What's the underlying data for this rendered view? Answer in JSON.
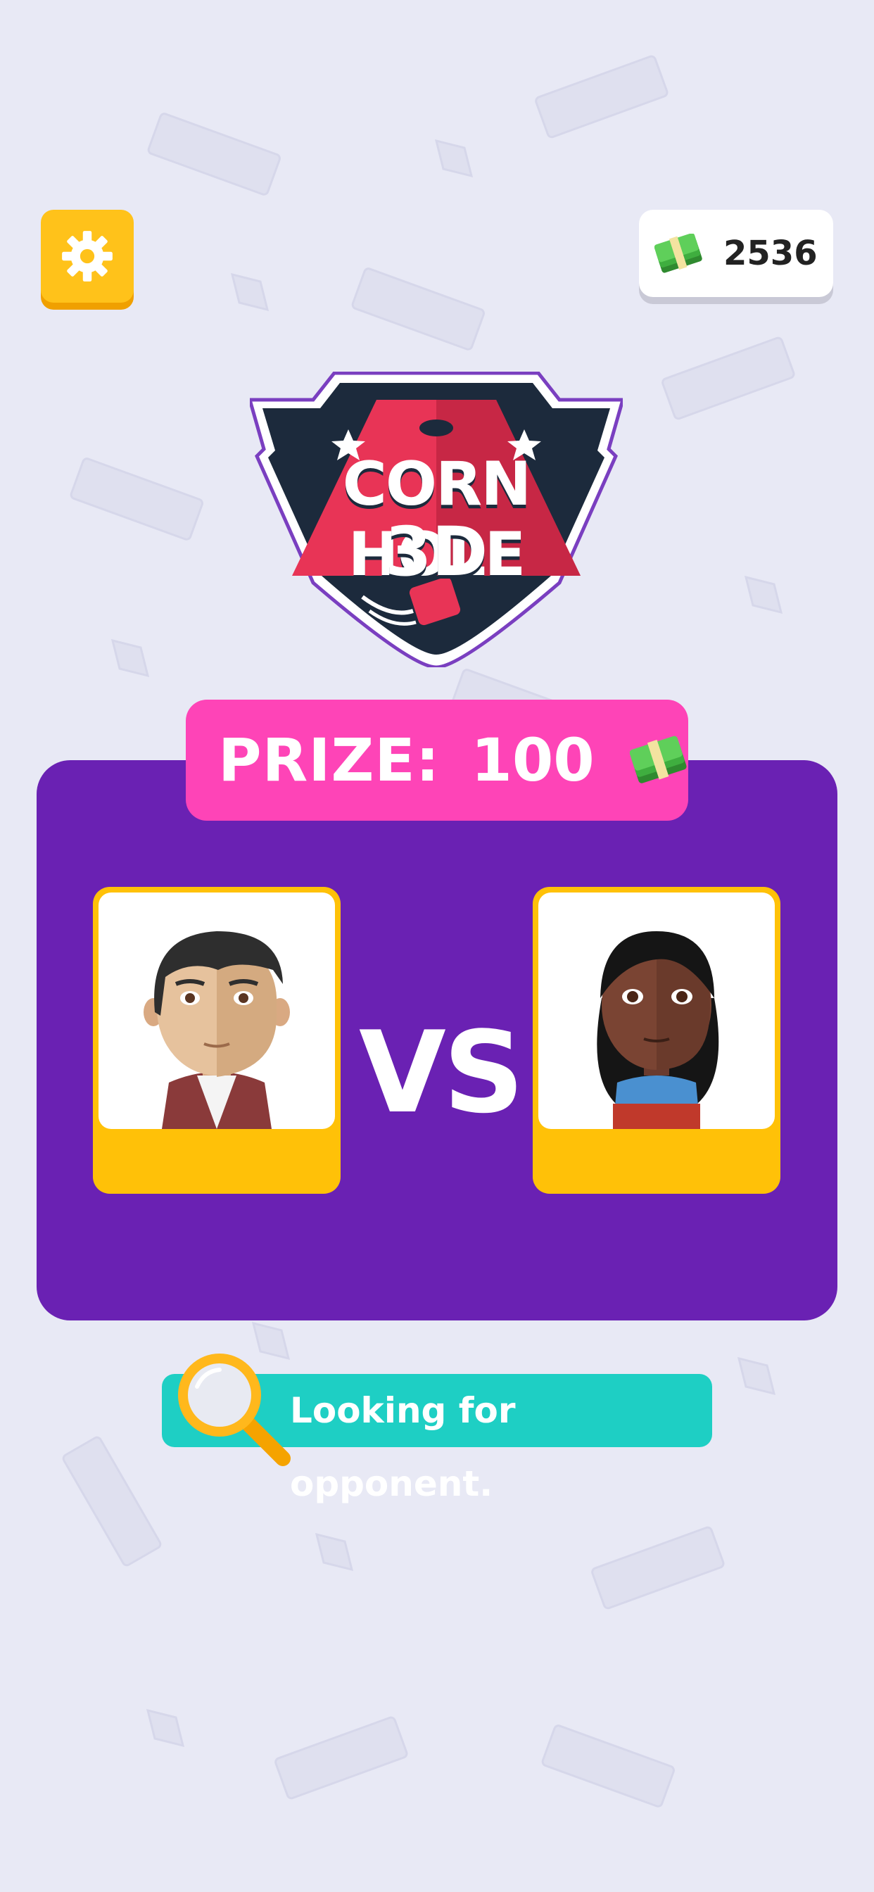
{
  "header": {
    "settings_icon": "gear-icon",
    "currency": {
      "icon": "cash-stack-icon",
      "amount": "2536"
    }
  },
  "logo": {
    "title": "CORN HOLE",
    "subtitle": "3D"
  },
  "prize": {
    "label": "PRIZE:",
    "amount": "100",
    "icon": "cash-stack-icon"
  },
  "match": {
    "vs_label": "VS",
    "player_left": {
      "avatar": "male-avatar"
    },
    "player_right": {
      "avatar": "female-avatar"
    }
  },
  "status": {
    "text": "Looking for opponent.",
    "icon": "magnifier-icon"
  },
  "colors": {
    "background": "#e8e9f5",
    "settings": "#ffc21a",
    "panel": "#6a21b3",
    "prize_banner": "#fe44b7",
    "card": "#ffc108",
    "status_bar": "#1ecfc4"
  }
}
